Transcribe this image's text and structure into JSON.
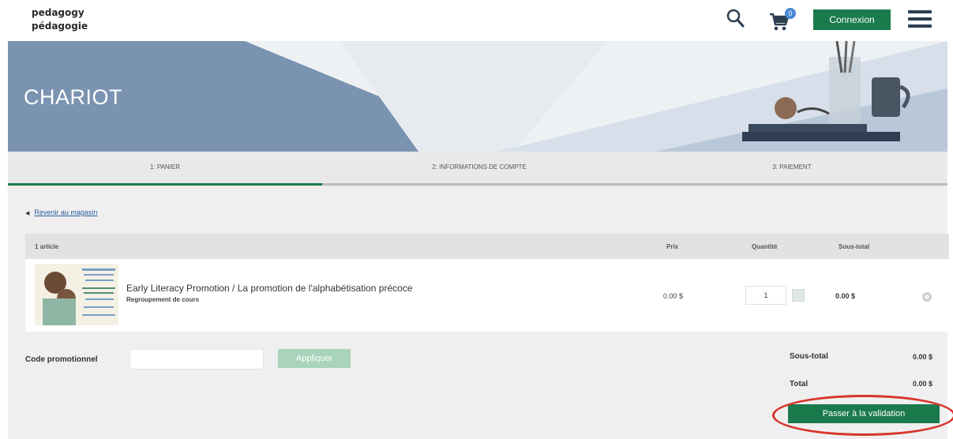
{
  "header": {
    "logo_line1": "pedagogy",
    "logo_line2": "pédagogie",
    "cart_count": "0",
    "login_label": "Connexion"
  },
  "banner": {
    "title": "CHARIOT"
  },
  "steps": [
    "1: PANIER",
    "2: INFORMATIONS DE COMPTE",
    "3: PAIEMENT"
  ],
  "back_link": "Revenir au magasin",
  "table": {
    "headers": {
      "items": "1 article",
      "price": "Prix",
      "quantity": "Quantité",
      "subtotal": "Sous-total"
    },
    "rows": [
      {
        "title": "Early Literacy Promotion / La promotion de l'alphabétisation précoce",
        "subtitle": "Regroupement de cours",
        "price": "0.00 $",
        "quantity": "1",
        "subtotal": "0.00 $"
      }
    ]
  },
  "promo": {
    "label": "Code promotionnel",
    "apply_label": "Appliquer"
  },
  "summary": {
    "subtotal_label": "Sous-total",
    "subtotal_value": "0.00 $",
    "total_label": "Total",
    "total_value": "0.00 $"
  },
  "checkout_label": "Passer à la validation",
  "colors": {
    "brand_green": "#1a7a4c",
    "apply_disabled": "#a9d3bb",
    "annotation_red": "#d9342b",
    "banner_blue": "#7a93b0"
  },
  "icons": [
    "search-icon",
    "cart-icon",
    "menu-icon",
    "chevron-left-icon",
    "remove-icon"
  ]
}
